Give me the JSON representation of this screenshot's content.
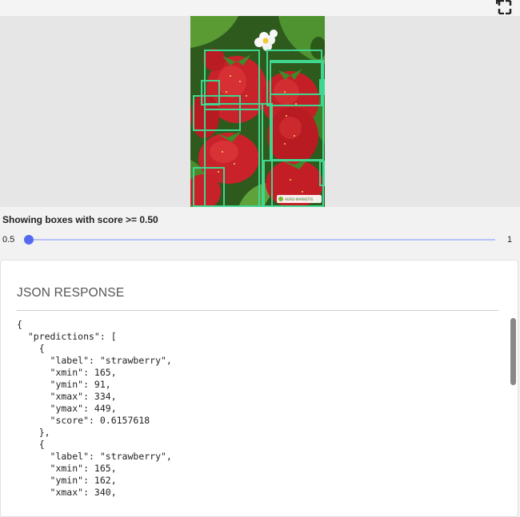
{
  "header": {
    "fullscreen_icon": "fullscreen-icon"
  },
  "image_viewer": {
    "subject": "strawberries photo",
    "watermark": "AGRO-MARKETIS",
    "box_color": "#3fd68f",
    "box_count": 12
  },
  "threshold": {
    "status_text": "Showing boxes with score >= 0.50",
    "min_label": "0.5",
    "max_label": "1",
    "value": 0.5,
    "min": 0.5,
    "max": 1,
    "accent_color": "#5569f0"
  },
  "json_panel": {
    "title": "JSON RESPONSE",
    "code": "{\n  \"predictions\": [\n    {\n      \"label\": \"strawberry\",\n      \"xmin\": 165,\n      \"ymin\": 91,\n      \"xmax\": 334,\n      \"ymax\": 449,\n      \"score\": 0.6157618\n    },\n    {\n      \"label\": \"strawberry\",\n      \"xmin\": 165,\n      \"ymin\": 162,\n      \"xmax\": 340,"
  }
}
